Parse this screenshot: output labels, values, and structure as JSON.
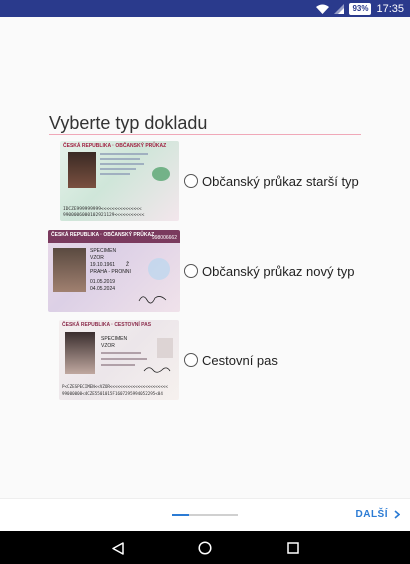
{
  "status_bar": {
    "time": "17:35",
    "battery": "93%",
    "background": "#2a3a8c"
  },
  "page": {
    "title": "Vyberte typ dokladu",
    "options": [
      {
        "label": "Občanský průkaz starší typ",
        "card_tint": "#dfeee4",
        "icon": "old-id-card-image"
      },
      {
        "label": "Občanský průkaz nový typ",
        "card_tint": "#ead9e8",
        "icon": "new-id-card-image"
      },
      {
        "label": "Cestovní pas",
        "card_tint": "#f2ecec",
        "icon": "passport-image"
      }
    ]
  },
  "bottom_bar": {
    "next_label": "DALŠÍ",
    "progress": 0.25,
    "accent": "#2b7bd4"
  },
  "card_text": {
    "old": {
      "header": "ČESKÁ REPUBLIKA · OBČANSKÝ PRŮKAZ",
      "mrz1": "IDCZE999999999<<<<<<<<<<<<<<<",
      "mrz2": "9900006000102921129<<<<<<<<<<<"
    },
    "new": {
      "header": "ČESKÁ REPUBLIKA · OBČANSKÝ PRŮKAZ",
      "number": "998006662",
      "surname": "SPECIMEN",
      "given": "VZOR",
      "dob": "19.10.1961",
      "sex": "Ž",
      "place": "PRAHA - PRONNI",
      "issued": "01.05.2019",
      "expiry": "04.05.2024"
    },
    "passport": {
      "header": "ČESKÁ REPUBLIKA · CESTOVNÍ PAS",
      "surname": "SPECIMEN",
      "given": "VZOR",
      "mrz1": "P<CZESPECIMEN<<VZOR<<<<<<<<<<<<<<<<<<<<<<<",
      "mrz2": "99000000<4CZE5501015F1607295994052295<04"
    }
  }
}
